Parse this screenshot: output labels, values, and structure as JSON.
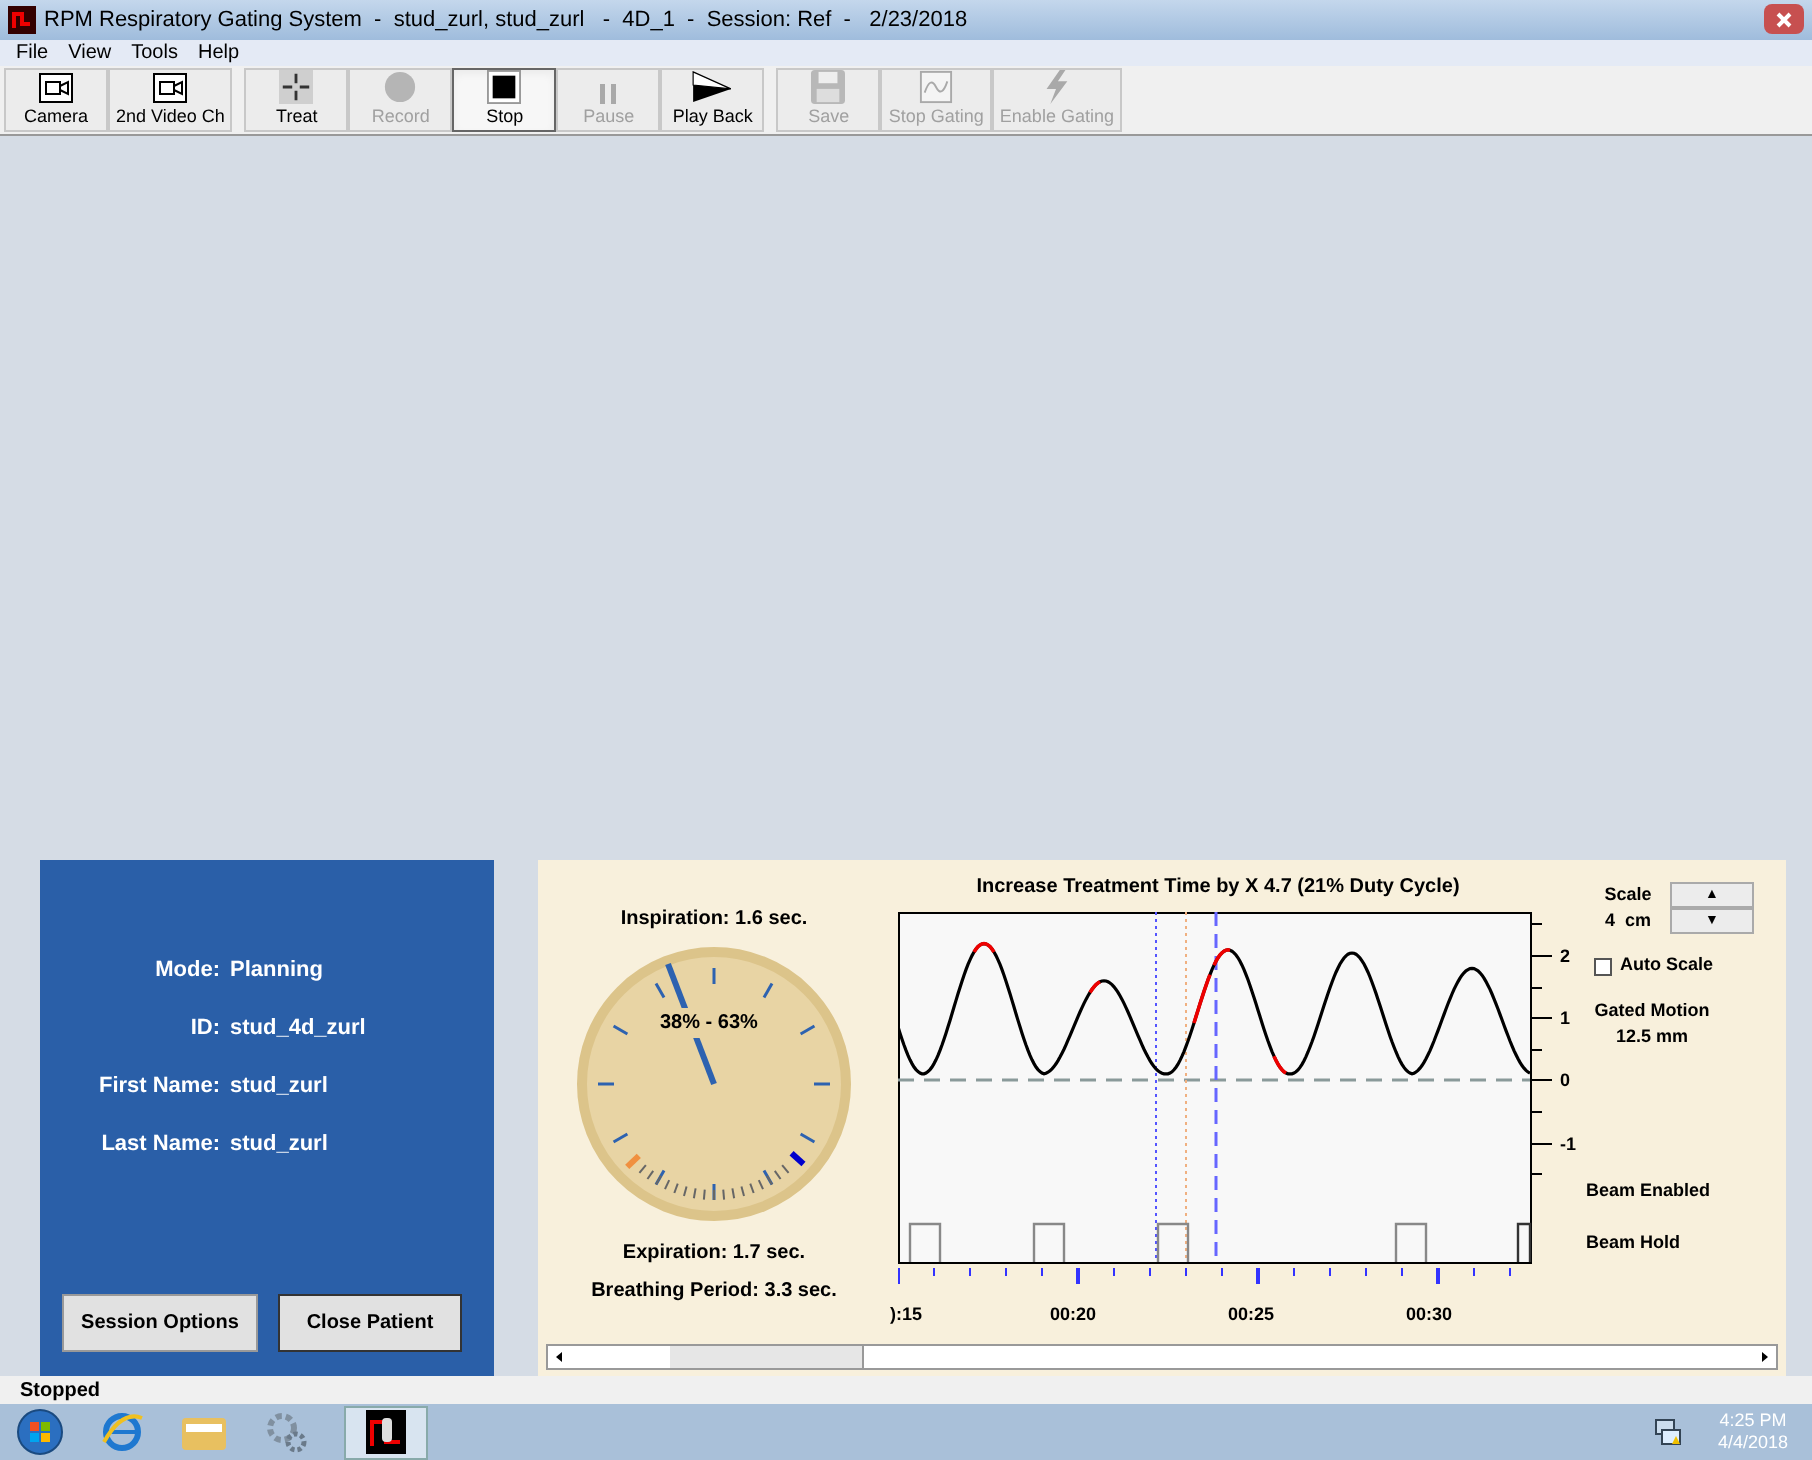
{
  "window": {
    "title": "RPM Respiratory Gating System  -  stud_zurl, stud_zurl   -  4D_1  -  Session: Ref  -   2/23/2018"
  },
  "menu": [
    "File",
    "View",
    "Tools",
    "Help"
  ],
  "toolbar": [
    {
      "label": "Camera",
      "kind": "camera",
      "disabled": false,
      "selected": false
    },
    {
      "label": "2nd Video Ch",
      "kind": "camera",
      "disabled": false,
      "selected": false
    },
    {
      "label": "Treat",
      "kind": "treat",
      "disabled": false,
      "selected": false
    },
    {
      "label": "Record",
      "kind": "record",
      "disabled": true,
      "selected": false
    },
    {
      "label": "Stop",
      "kind": "stop",
      "disabled": false,
      "selected": true
    },
    {
      "label": "Pause",
      "kind": "pause",
      "disabled": true,
      "selected": false
    },
    {
      "label": "Play Back",
      "kind": "play",
      "disabled": false,
      "selected": false
    },
    {
      "label": "Save",
      "kind": "save",
      "disabled": true,
      "selected": false
    },
    {
      "label": "Stop Gating",
      "kind": "gate",
      "disabled": true,
      "selected": false
    },
    {
      "label": "Enable Gating",
      "kind": "bolt",
      "disabled": true,
      "selected": false
    }
  ],
  "patient": {
    "fields": [
      {
        "label": "Mode:",
        "value": "Planning"
      },
      {
        "label": "ID:",
        "value": "stud_4d_zurl"
      },
      {
        "label": "First Name:",
        "value": "stud_zurl"
      },
      {
        "label": "Last Name:",
        "value": "stud_zurl"
      }
    ],
    "buttons": [
      "Session Options",
      "Close Patient"
    ]
  },
  "gauge": {
    "inspiration": "Inspiration: 1.6 sec.",
    "window": "38% - 63%",
    "expiration": "Expiration: 1.7 sec.",
    "period": "Breathing Period: 3.3 sec."
  },
  "trace": {
    "title": "Increase Treatment Time by X 4.7 (21% Duty Cycle)",
    "y_labels": [
      "2",
      "1",
      "0",
      "-1"
    ],
    "beam_labels": [
      "Beam Enabled",
      "Beam Hold"
    ],
    "x_labels": [
      "):15",
      "00:20",
      "00:25",
      "00:30"
    ],
    "scale_label": "Scale",
    "scale_value": "4  cm",
    "scale_up": "▲",
    "scale_down": "▼",
    "auto_scale": {
      "label": "Auto Scale",
      "checked": false
    },
    "gated_motion": "Gated Motion",
    "gated_value": "12.5 mm"
  },
  "status_bar": "Stopped",
  "taskbar": {
    "time": "4:25 PM",
    "date": "4/4/2018"
  }
}
